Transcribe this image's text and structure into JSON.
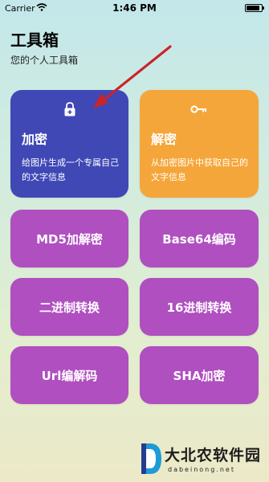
{
  "status_bar": {
    "carrier": "Carrier",
    "time": "1:46 PM",
    "battery_level": 0.9
  },
  "header": {
    "title": "工具箱",
    "subtitle": "您的个人工具箱"
  },
  "cards": [
    {
      "name": "加密",
      "desc": "给图片生成一个专属自己的文字信息",
      "icon": "lock-icon",
      "color": "#3f48b5"
    },
    {
      "name": "解密",
      "desc": "从加密图片中获取自己的文字信息",
      "icon": "key-icon",
      "color": "#f5a63a"
    }
  ],
  "buttons": [
    "MD5加解密",
    "Base64编码",
    "二进制转换",
    "16进制转换",
    "Url编解码",
    "SHA加密"
  ],
  "button_color": "#b04fc0",
  "watermark": {
    "text": "大北农软件园",
    "url": "dabeinong.net"
  }
}
